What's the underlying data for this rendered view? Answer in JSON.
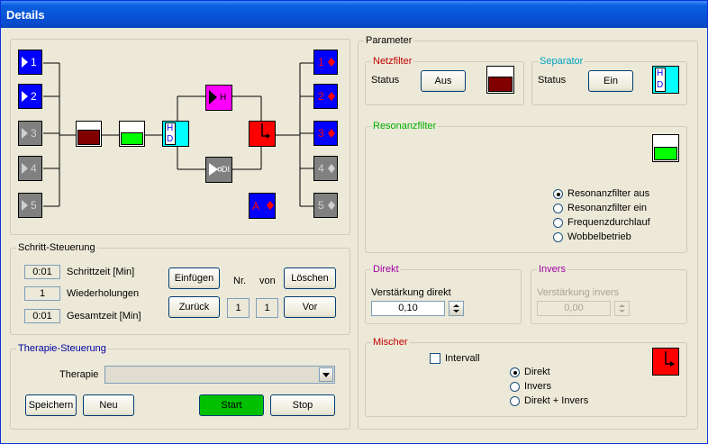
{
  "window": {
    "title": "Details"
  },
  "left_diagram": {
    "inputs": [
      {
        "label": "1",
        "active": true
      },
      {
        "label": "2",
        "active": true
      },
      {
        "label": "3",
        "active": false
      },
      {
        "label": "4",
        "active": false
      },
      {
        "label": "5",
        "active": false
      }
    ],
    "outputs": [
      {
        "label": "1",
        "active": true
      },
      {
        "label": "2",
        "active": true
      },
      {
        "label": "3",
        "active": true
      },
      {
        "label": "4",
        "active": false
      },
      {
        "label": "5",
        "active": false
      }
    ],
    "hd_top": "H",
    "hd_bottom": "D",
    "h_label": "H",
    "di_label": "DI",
    "a_label": "A"
  },
  "schritt": {
    "legend": "Schritt-Steuerung",
    "schrittzeit_value": "0:01",
    "schrittzeit_label": "Schrittzeit [Min]",
    "wiederholungen_value": "1",
    "wiederholungen_label": "Wiederholungen",
    "gesamtzeit_value": "0:01",
    "gesamtzeit_label": "Gesamtzeit [Min]",
    "einfuegen": "Einfügen",
    "zurueck": "Zurück",
    "nr_label": "Nr.",
    "von_label": "von",
    "nr_value": "1",
    "von_value": "1",
    "loeschen": "Löschen",
    "vor": "Vor"
  },
  "therapie": {
    "legend": "Therapie-Steuerung",
    "label": "Therapie",
    "selected": "",
    "speichern": "Speichern",
    "neu": "Neu",
    "start": "Start",
    "stop": "Stop"
  },
  "parameter": {
    "legend": "Parameter",
    "netzfilter": {
      "legend": "Netzfilter",
      "status_label": "Status",
      "button": "Aus"
    },
    "separator": {
      "legend": "Separator",
      "status_label": "Status",
      "button": "Ein",
      "hd_top": "H",
      "hd_bottom": "D"
    },
    "resonanzfilter": {
      "legend": "Resonanzfilter",
      "options": [
        "Resonanzfilter aus",
        "Resonanzfilter ein",
        "Frequenzdurchlauf",
        "Wobbelbetrieb"
      ],
      "selected_index": 0
    },
    "direkt": {
      "legend": "Direkt",
      "label": "Verstärkung direkt",
      "value": "0,10"
    },
    "invers": {
      "legend": "Invers",
      "label": "Verstärkung invers",
      "value": "0,00"
    },
    "mischer": {
      "legend": "Mischer",
      "intervall_label": "Intervall",
      "intervall_checked": false,
      "options": [
        "Direkt",
        "Invers",
        "Direkt + Invers"
      ],
      "selected_index": 0
    }
  },
  "colors": {
    "blue_tile": "#0000ff",
    "gray_tile": "#808080",
    "magenta": "#ff00ff",
    "red": "#ff0000",
    "cyan": "#00ffff",
    "dark_red": "#800000",
    "green": "#00ff00",
    "start_green": "#00c000",
    "netzfilter_legend": "#c00000",
    "separator_legend": "#00a0c0",
    "resonanz_legend": "#00b000",
    "direkt_legend": "#a000a0",
    "mischer_legend": "#c00000"
  }
}
